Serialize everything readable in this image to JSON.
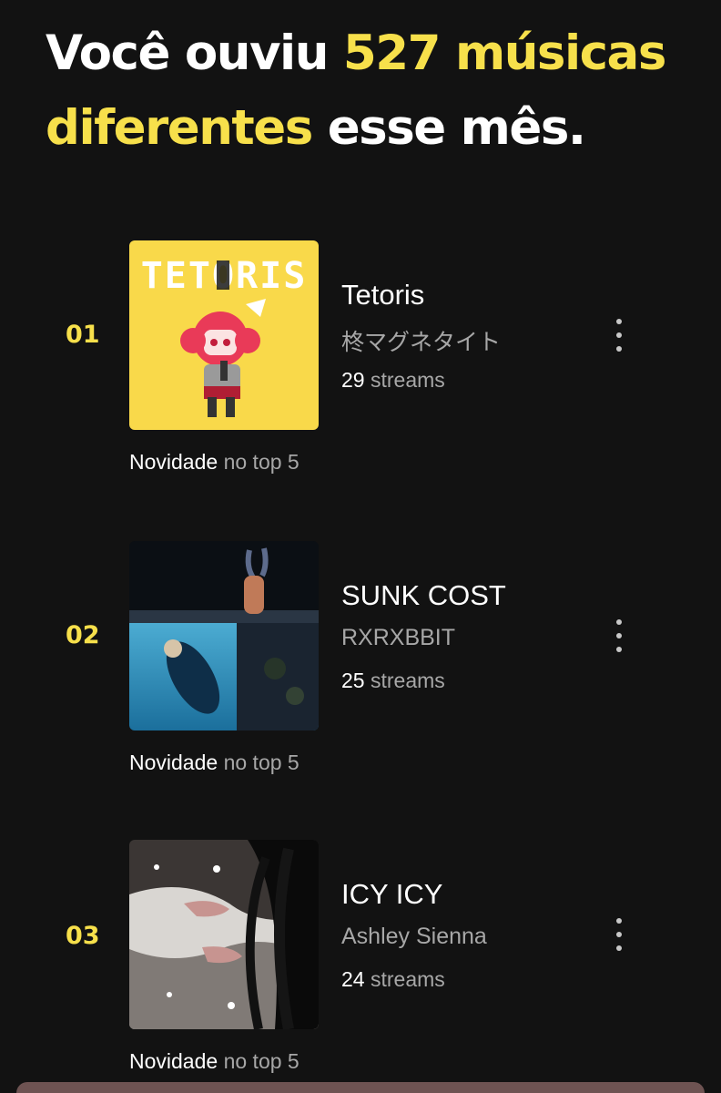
{
  "header": {
    "prefix": "Você ouviu ",
    "highlight": "527 músicas diferentes",
    "suffix": " esse mês.",
    "accent_color": "#f7e04b"
  },
  "tracks": [
    {
      "rank": "01",
      "title": "Tetoris",
      "artist": "柊マグネタイト",
      "streams_count": "29",
      "streams_label": "streams",
      "badge_strong": "Novidade",
      "badge_rest": "no top 5",
      "cover_text": "TETORIS",
      "cover_icon": "tetoris-album-cover"
    },
    {
      "rank": "02",
      "title": "SUNK COST",
      "artist": "RXRXBBIT",
      "streams_count": "25",
      "streams_label": "streams",
      "badge_strong": "Novidade",
      "badge_rest": "no top 5",
      "cover_icon": "sunk-cost-album-cover"
    },
    {
      "rank": "03",
      "title": "ICY ICY",
      "artist": "Ashley Sienna",
      "streams_count": "24",
      "streams_label": "streams",
      "badge_strong": "Novidade",
      "badge_rest": "no top 5",
      "cover_icon": "icy-icy-album-cover"
    }
  ],
  "more_icon": "more-vertical-icon"
}
